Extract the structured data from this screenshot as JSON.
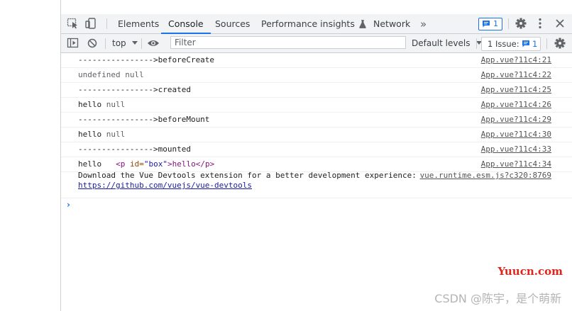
{
  "tabs": [
    {
      "label": "Elements",
      "active": false
    },
    {
      "label": "Console",
      "active": true
    },
    {
      "label": "Sources",
      "active": false
    },
    {
      "label": "Performance insights",
      "active": false
    },
    {
      "label": "Network",
      "active": false
    }
  ],
  "more_tabs_glyph": "»",
  "message_badge_count": "1",
  "console_toolbar": {
    "context": "top",
    "filter_placeholder": "Filter",
    "levels": "Default levels",
    "issues_label": "1 Issue:",
    "issues_count": "1"
  },
  "messages": [
    {
      "parts": [
        "---------------->beforeCreate"
      ],
      "source": "App.vue?11c4:21"
    },
    {
      "parts": [
        "undefined",
        " ",
        "null"
      ],
      "source": "App.vue?11c4:22"
    },
    {
      "parts": [
        "---------------->created"
      ],
      "source": "App.vue?11c4:25"
    },
    {
      "parts": [
        "hello",
        " ",
        "null"
      ],
      "source": "App.vue?11c4:26"
    },
    {
      "parts": [
        "---------------->beforeMount"
      ],
      "source": "App.vue?11c4:29"
    },
    {
      "parts": [
        "hello",
        " ",
        "null"
      ],
      "source": "App.vue?11c4:30"
    },
    {
      "parts": [
        "---------------->mounted"
      ],
      "source": "App.vue?11c4:33"
    },
    {
      "parts": [
        "hello"
      ],
      "element": {
        "open": "<p",
        "attr": " id=",
        "val": "\"box\"",
        "close": ">hello</p>"
      },
      "source": "App.vue?11c4:34"
    }
  ],
  "devtools_message": {
    "text": "Download the Vue Devtools extension for a better development experience:",
    "source": "vue.runtime.esm.js?c320:8769",
    "link": "https://github.com/vuejs/vue-devtools"
  },
  "prompt_glyph": "›",
  "watermarks": {
    "site": "Yuucn.com",
    "csdn": "CSDN @陈宇，是个萌新"
  },
  "colors": {
    "accent": "#1a73e8",
    "toolbar_bg": "#f1f3f4",
    "watermark_red": "#e0251c"
  }
}
